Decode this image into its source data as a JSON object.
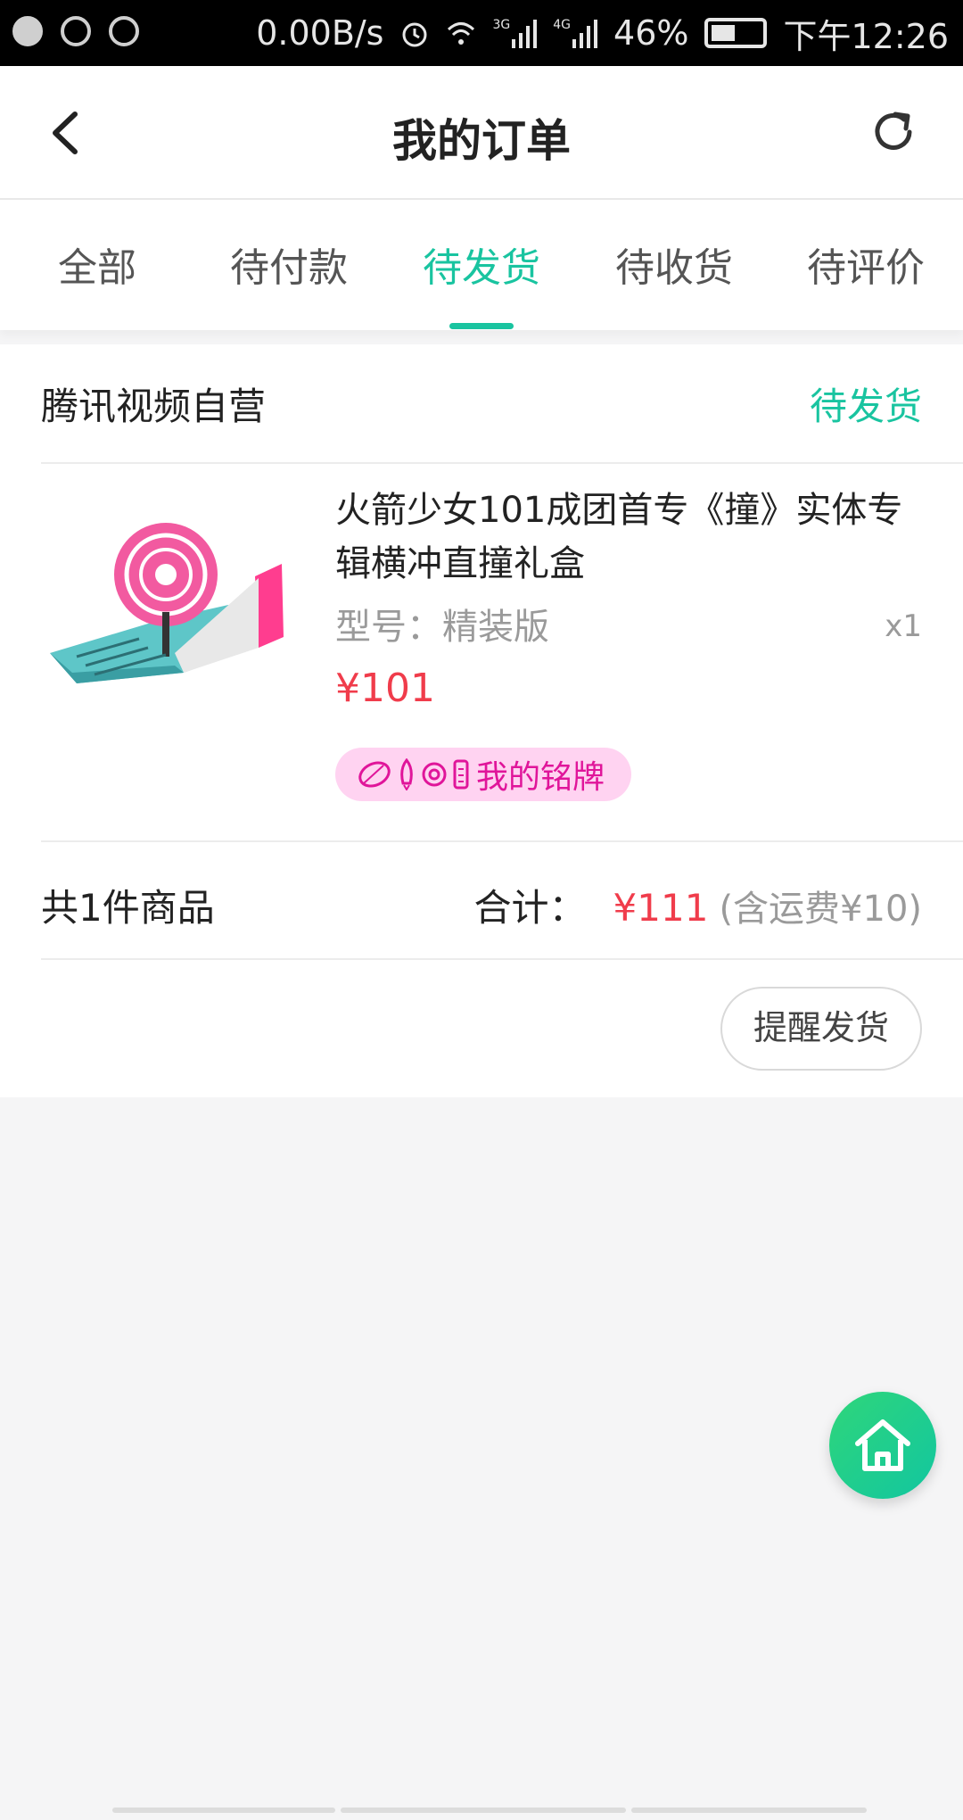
{
  "status_bar": {
    "net_speed": "0.00B/s",
    "net_3g": "3G",
    "net_4g": "4G",
    "battery": "46%",
    "time": "下午12:26"
  },
  "header": {
    "title": "我的订单",
    "back_icon": "chevron-left-icon",
    "refresh_icon": "refresh-icon"
  },
  "tabs": [
    {
      "label": "全部",
      "active": false
    },
    {
      "label": "待付款",
      "active": false
    },
    {
      "label": "待发货",
      "active": true
    },
    {
      "label": "待收货",
      "active": false
    },
    {
      "label": "待评价",
      "active": false
    }
  ],
  "order": {
    "shop_name": "腾讯视频自营",
    "status": "待发货",
    "product": {
      "title": "火箭少女101成团首专《撞》实体专辑横冲直撞礼盒",
      "spec": "型号：精装版",
      "qty": "x1",
      "price": "¥101",
      "badge_label": "我的铭牌"
    },
    "summary": {
      "count_text": "共1件商品",
      "total_label": "合计：",
      "total": "¥111",
      "shipping": "(含运费¥10)"
    },
    "action_button": "提醒发货"
  },
  "fab": {
    "icon": "home-icon"
  },
  "colors": {
    "accent": "#19c4a0",
    "price": "#f03c4b",
    "badge_bg": "#ffd3f1",
    "badge_text": "#e0159a"
  }
}
